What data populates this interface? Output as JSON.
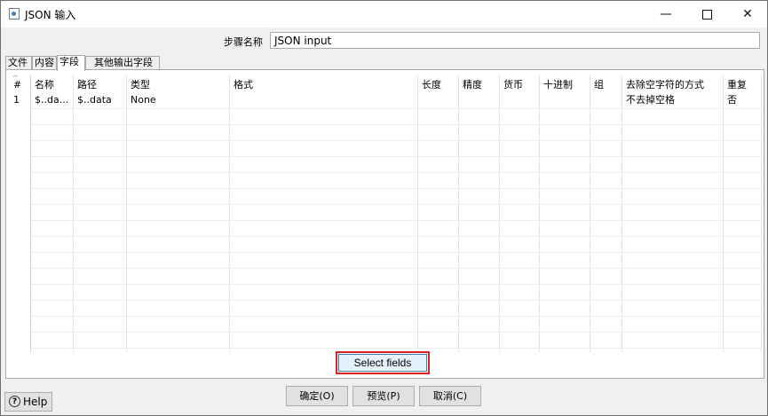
{
  "window": {
    "title": "JSON 输入",
    "controls": {
      "minimize": "—",
      "close": "✕"
    }
  },
  "step": {
    "label": "步骤名称",
    "value": "JSON input"
  },
  "tabs": [
    {
      "label": "文件"
    },
    {
      "label": "内容"
    },
    {
      "label": "字段",
      "active": true
    },
    {
      "label": "其他输出字段"
    }
  ],
  "table": {
    "columns": [
      "#",
      "名称",
      "路径",
      "类型",
      "格式",
      "长度",
      "精度",
      "货币",
      "十进制",
      "组",
      "去除空字符的方式",
      "重复"
    ],
    "rows": [
      [
        "1",
        "$..da...",
        "$..data",
        "None",
        "",
        "",
        "",
        "",
        "",
        "",
        "不去掉空格",
        "否"
      ]
    ]
  },
  "buttons": {
    "select_fields": "Select fields",
    "ok": "确定(O)",
    "preview": "预览(P)",
    "cancel": "取消(C)",
    "help": "Help",
    "help_icon": "?"
  }
}
